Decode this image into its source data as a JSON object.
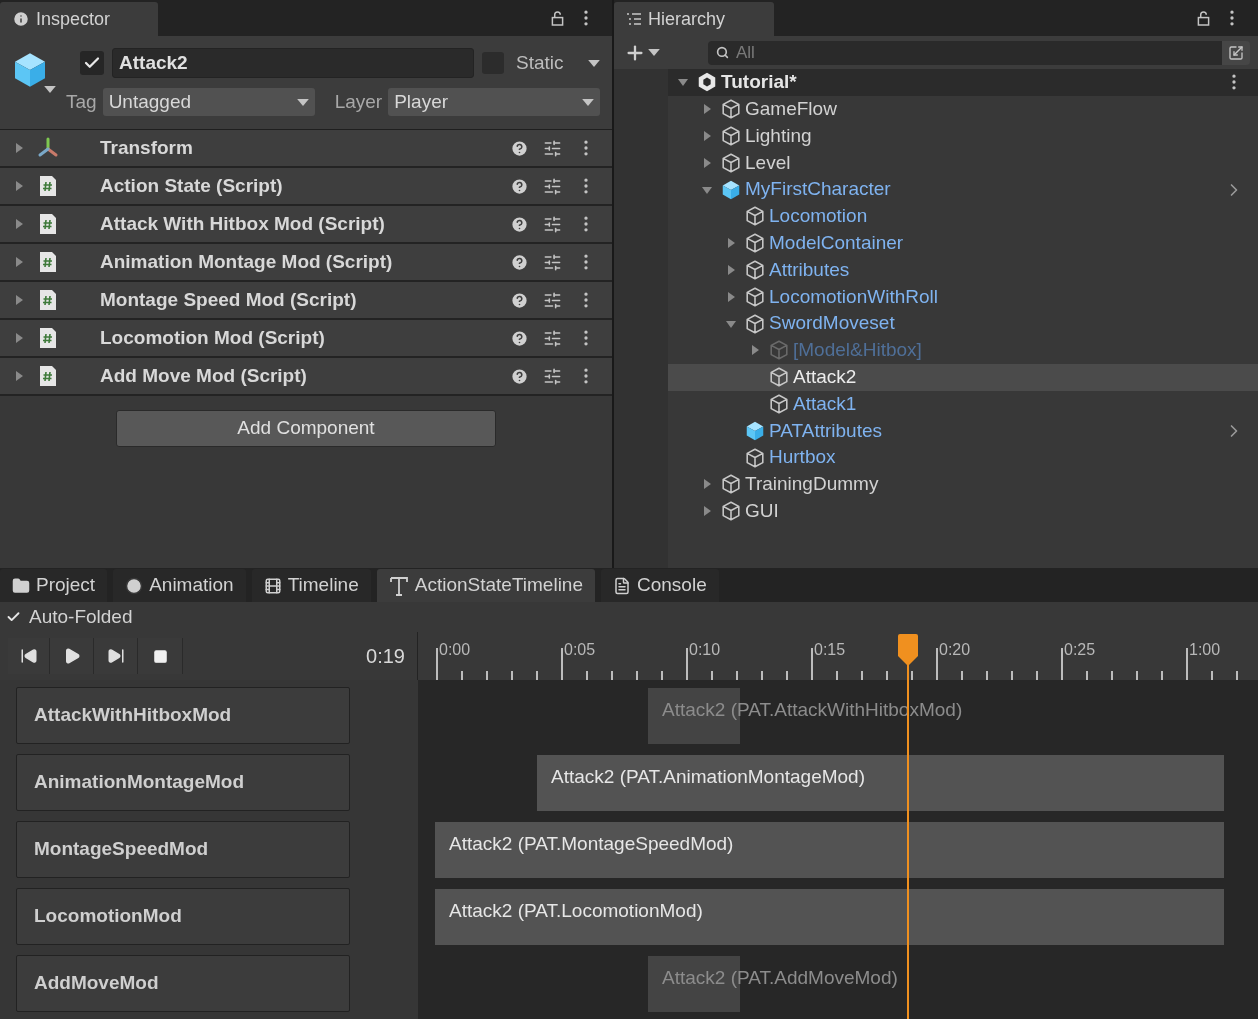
{
  "inspector": {
    "tab": "Inspector",
    "object": {
      "active": true,
      "name": "Attack2",
      "static": false,
      "static_label": "Static",
      "tag_label": "Tag",
      "tag": "Untagged",
      "layer_label": "Layer",
      "layer": "Player"
    },
    "components": [
      {
        "kind": "transform",
        "name": "Transform",
        "expanded": false
      },
      {
        "kind": "script",
        "name": "Action State (Script)",
        "expanded": false
      },
      {
        "kind": "script",
        "name": "Attack With Hitbox Mod (Script)",
        "expanded": false
      },
      {
        "kind": "script",
        "name": "Animation Montage Mod (Script)",
        "expanded": false
      },
      {
        "kind": "script",
        "name": "Montage Speed Mod (Script)",
        "expanded": false
      },
      {
        "kind": "script",
        "name": "Locomotion Mod (Script)",
        "expanded": false
      },
      {
        "kind": "script",
        "name": "Add Move Mod (Script)",
        "expanded": false
      }
    ],
    "add_button": "Add Component"
  },
  "hierarchy": {
    "tab": "Hierarchy",
    "search": {
      "placeholder": "All"
    },
    "tree": [
      {
        "name": "Tutorial*",
        "kind": "scene",
        "expanded": true,
        "selected": false,
        "active": true,
        "children": [
          {
            "name": "GameFlow",
            "kind": "object",
            "expanded": false,
            "selected": false,
            "active": true
          },
          {
            "name": "Lighting",
            "kind": "object",
            "expanded": false,
            "selected": false,
            "active": true
          },
          {
            "name": "Level",
            "kind": "object",
            "expanded": false,
            "selected": false,
            "active": true
          },
          {
            "name": "MyFirstCharacter",
            "kind": "prefab_root",
            "expanded": true,
            "selected": false,
            "active": true,
            "children": [
              {
                "name": "Locomotion",
                "kind": "prefab_child",
                "selected": false,
                "active": true
              },
              {
                "name": "ModelContainer",
                "kind": "prefab_child",
                "expanded": false,
                "selected": false,
                "active": true
              },
              {
                "name": "Attributes",
                "kind": "prefab_child",
                "expanded": false,
                "selected": false,
                "active": true
              },
              {
                "name": "LocomotionWithRoll",
                "kind": "prefab_child",
                "expanded": false,
                "selected": false,
                "active": true
              },
              {
                "name": "SwordMoveset",
                "kind": "prefab_child",
                "expanded": true,
                "selected": false,
                "active": true,
                "children": [
                  {
                    "name": "[Model&Hitbox]",
                    "kind": "prefab_child",
                    "expanded": false,
                    "selected": false,
                    "active": false
                  },
                  {
                    "name": "Attack2",
                    "kind": "prefab_child",
                    "selected": true,
                    "active": true
                  },
                  {
                    "name": "Attack1",
                    "kind": "prefab_child",
                    "selected": false,
                    "active": true
                  }
                ]
              },
              {
                "name": "PATAttributes",
                "kind": "prefab_root",
                "selected": false,
                "active": true
              },
              {
                "name": "Hurtbox",
                "kind": "prefab_child",
                "selected": false,
                "active": true
              }
            ]
          },
          {
            "name": "TrainingDummy",
            "kind": "object",
            "expanded": false,
            "selected": false,
            "active": true
          },
          {
            "name": "GUI",
            "kind": "object",
            "expanded": false,
            "selected": false,
            "active": true
          }
        ]
      }
    ]
  },
  "bottom": {
    "tabs": [
      {
        "label": "Project",
        "kind": "project",
        "selected": false
      },
      {
        "label": "Animation",
        "kind": "animation",
        "selected": false
      },
      {
        "label": "Timeline",
        "kind": "timeline",
        "selected": false
      },
      {
        "label": "ActionStateTimeline",
        "kind": "action",
        "selected": true
      },
      {
        "label": "Console",
        "kind": "console",
        "selected": false
      }
    ],
    "auto_folded": {
      "label": "Auto-Folded",
      "checked": true
    },
    "time": "0:19",
    "ruler": [
      "0:00",
      "0:05",
      "0:10",
      "0:15",
      "0:20",
      "0:25",
      "1:00"
    ],
    "tracks": [
      {
        "name": "AttackWithHitboxMod",
        "clip": {
          "label": "Attack2 (PAT.AttackWithHitboxMod)",
          "kind": "short"
        }
      },
      {
        "name": "AnimationMontageMod",
        "clip": {
          "label": "Attack2 (PAT.AnimationMontageMod)",
          "kind": "long"
        }
      },
      {
        "name": "MontageSpeedMod",
        "clip": {
          "label": "Attack2 (PAT.MontageSpeedMod)",
          "kind": "long"
        }
      },
      {
        "name": "LocomotionMod",
        "clip": {
          "label": "Attack2 (PAT.LocomotionMod)",
          "kind": "long"
        }
      },
      {
        "name": "AddMoveMod",
        "clip": {
          "label": "Attack2 (PAT.AddMoveMod)",
          "kind": "short"
        }
      }
    ]
  }
}
